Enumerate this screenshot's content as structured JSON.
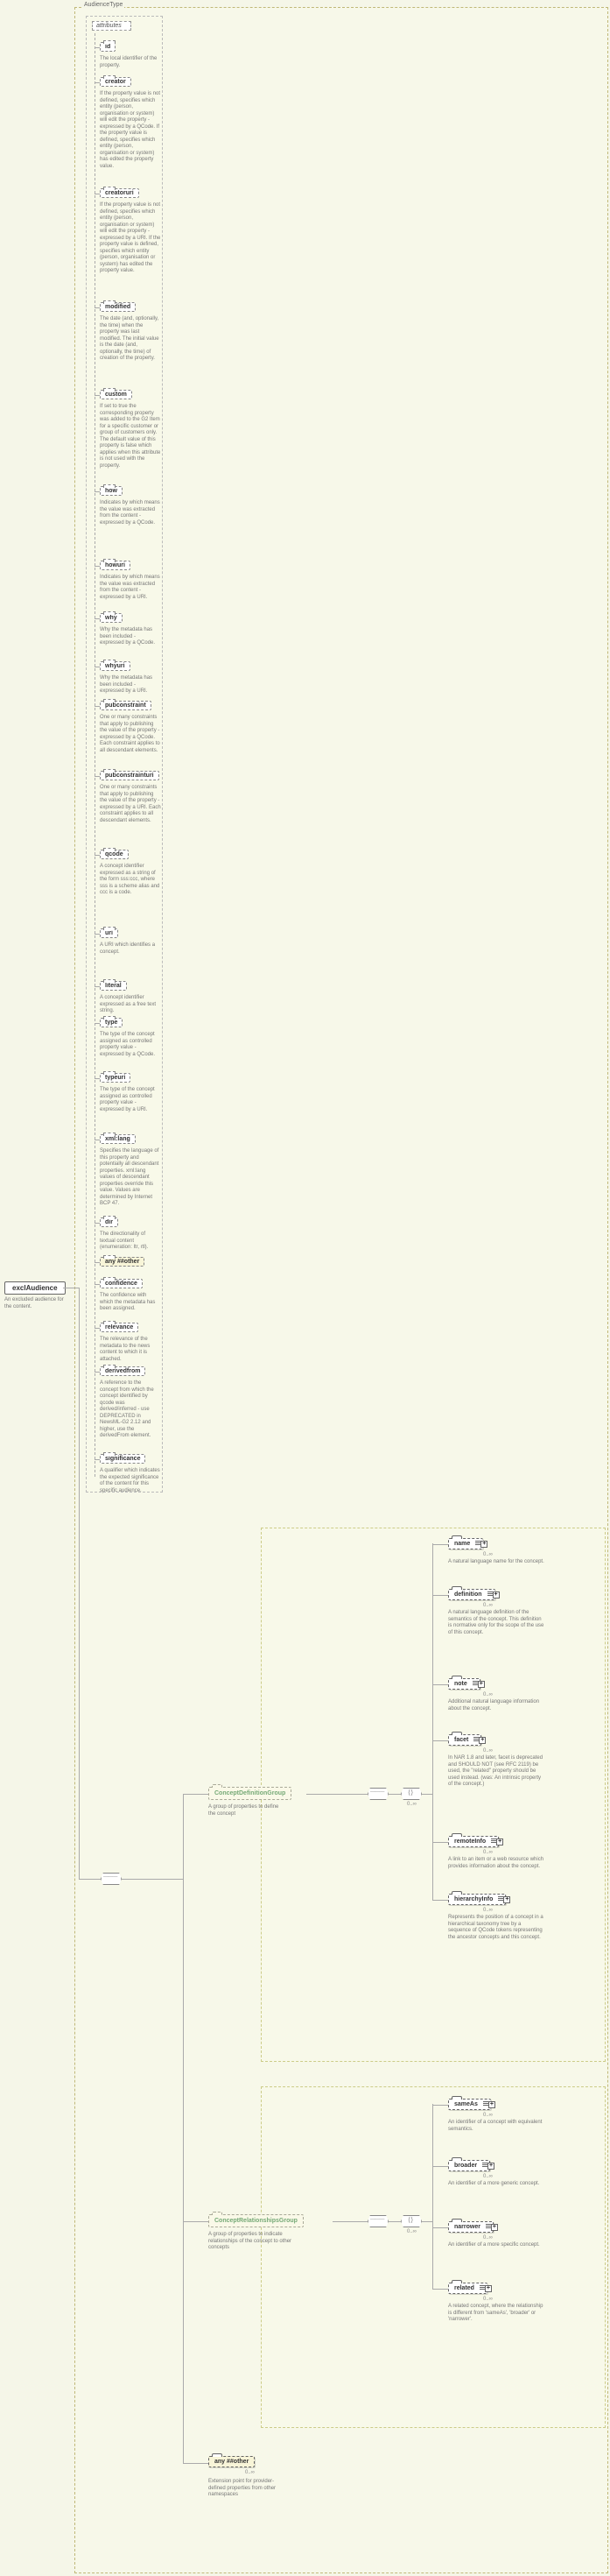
{
  "audienceType": "AudienceType",
  "root": {
    "name": "exclAudience",
    "desc": "An excluded audience for the content."
  },
  "attributesLabel": "attributes",
  "attrs": [
    {
      "name": "id",
      "desc": "The local identifier of the property."
    },
    {
      "name": "creator",
      "desc": "If the property value is not defined, specifies which entity (person, organisation or system) will edit the property - expressed by a QCode. If the property value is defined, specifies which entity (person, organisation or system) has edited the property value."
    },
    {
      "name": "creatoruri",
      "desc": "If the property value is not defined, specifies which entity (person, organisation or system) will edit the property - expressed by a URI. If the property value is defined, specifies which entity (person, organisation or system) has edited the property value."
    },
    {
      "name": "modified",
      "desc": "The date (and, optionally, the time) when the property was last modified. The initial value is the date (and, optionally, the time) of creation of the property."
    },
    {
      "name": "custom",
      "desc": "If set to true the corresponding property was added to the G2 Item for a specific customer or group of customers only. The default value of this property is false which applies when this attribute is not used with the property."
    },
    {
      "name": "how",
      "desc": "Indicates by which means the value was extracted from the content - expressed by a QCode."
    },
    {
      "name": "howuri",
      "desc": "Indicates by which means the value was extracted from the content - expressed by a URI."
    },
    {
      "name": "why",
      "desc": "Why the metadata has been included - expressed by a QCode."
    },
    {
      "name": "whyuri",
      "desc": "Why the metadata has been included - expressed by a URI."
    },
    {
      "name": "pubconstraint",
      "desc": "One or many constraints that apply to publishing the value of the property - expressed by a QCode. Each constraint applies to all descendant elements."
    },
    {
      "name": "pubconstrainturi",
      "desc": "One or many constraints that apply to publishing the value of the property - expressed by a URI. Each constraint applies to all descendant elements."
    },
    {
      "name": "qcode",
      "desc": "A concept identifier expressed as a string of the form sss:ccc, where sss is a scheme alias and ccc is a code."
    },
    {
      "name": "uri",
      "desc": "A URI which identifies a concept."
    },
    {
      "name": "literal",
      "desc": "A concept identifier expressed as a free text string."
    },
    {
      "name": "type",
      "desc": "The type of the concept assigned as controlled property value - expressed by a QCode."
    },
    {
      "name": "typeuri",
      "desc": "The type of the concept assigned as controlled property value - expressed by a URI."
    },
    {
      "name": "xml:lang",
      "desc": "Specifies the language of this property and potentially all descendant properties. xml:lang values of descendant properties override this value. Values are determined by Internet BCP 47."
    },
    {
      "name": "dir",
      "desc": "The directionality of textual content (enumeration: ltr, rtl)."
    },
    {
      "name": "any ##other",
      "desc": "",
      "dashed": true
    },
    {
      "name": "confidence",
      "desc": "The confidence with which the metadata has been assigned."
    },
    {
      "name": "relevance",
      "desc": "The relevance of the metadata to the news content to which it is attached."
    },
    {
      "name": "derivedfrom",
      "desc": "A reference to the concept from which the concept identified by qcode was derived/inferred - use DEPRECATED in NewsML-G2 2.12 and higher, use the derivedFrom element."
    },
    {
      "name": "significance",
      "desc": "A qualifier which indicates the expected significance of the content for this specific audience."
    }
  ],
  "cdg": {
    "name": "ConceptDefinitionGroup",
    "desc": "A group of properties to define the concept",
    "children": [
      {
        "name": "name",
        "desc": "A natural language name for the concept."
      },
      {
        "name": "definition",
        "desc": "A natural language definition of the semantics of the concept. This definition is normative only for the scope of the use of this concept."
      },
      {
        "name": "note",
        "desc": "Additional natural language information about the concept."
      },
      {
        "name": "facet",
        "desc": "In NAR 1.8 and later, facet is deprecated and SHOULD NOT (see RFC 2119) be used, the \"related\" property should be used instead. (was: An intrinsic property of the concept.)"
      },
      {
        "name": "remoteInfo",
        "desc": "A link to an item or a web resource which provides information about the concept."
      },
      {
        "name": "hierarchyInfo",
        "desc": "Represents the position of a concept in a hierarchical taxonomy tree by a sequence of QCode tokens representing the ancestor concepts and this concept."
      }
    ]
  },
  "crg": {
    "name": "ConceptRelationshipsGroup",
    "desc": "A group of properties to indicate relationships of the concept to other concepts",
    "children": [
      {
        "name": "sameAs",
        "desc": "An identifier of a concept with equivalent semantics."
      },
      {
        "name": "broader",
        "desc": "An identifier of a more generic concept."
      },
      {
        "name": "narrower",
        "desc": "An identifier of a more specific concept."
      },
      {
        "name": "related",
        "desc": "A related concept, where the relationship is different from 'sameAs', 'broader' or 'narrower'."
      }
    ]
  },
  "anyOther": {
    "name": "any ##other",
    "desc": "Extension point for provider-defined properties from other namespaces"
  },
  "occ": "0..∞"
}
